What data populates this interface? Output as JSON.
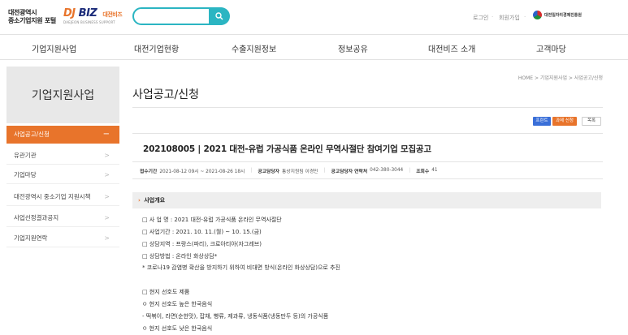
{
  "header": {
    "portal_name_line1": "대전광역시",
    "portal_name_line2": "중소기업지원 포털",
    "brand_dj": "DJ",
    "brand_biz": "BIZ",
    "brand_kr": "대전비즈",
    "brand_sub": "DAEJEON BUSINESS SUPPORT",
    "search_placeholder": "",
    "login_label": "로그인",
    "join_label": "회원가입",
    "util_dot": "·",
    "org_logo_text": "대전일자리경제진흥원",
    "accent_color": "#e8742b",
    "search_color": "#2bb5c2"
  },
  "nav": {
    "items": [
      "기업지원사업",
      "대전기업현황",
      "수출지원정보",
      "정보공유",
      "대전비즈 소개",
      "고객마당"
    ]
  },
  "sidebar": {
    "title": "기업지원사업",
    "items": [
      {
        "label": "사업공고/신청",
        "active": true,
        "icon": "−"
      },
      {
        "label": "유관기관",
        "active": false,
        "icon": ">"
      },
      {
        "label": "기업마당",
        "active": false,
        "icon": ">"
      },
      {
        "label": "대전광역시 중소기업 지원시책",
        "active": false,
        "icon": ">"
      },
      {
        "label": "사업선정결과공지",
        "active": false,
        "icon": ">"
      },
      {
        "label": "기업지원연락",
        "active": false,
        "icon": ">"
      }
    ]
  },
  "content": {
    "breadcrumb": "HOME > 기업지원사업 > 사업공고/신청",
    "page_title": "사업공고/신청",
    "buttons": {
      "print": "프린트",
      "apply": "과제 신청",
      "list": "목록"
    },
    "post_title": "202108005 | 2021 대전-유럽 가공식품 온라인 무역사절단 참여기업 모집공고",
    "meta": {
      "period_label": "접수기간",
      "period_value": "2021-08-12 09시 ~ 2021-08-26 18시",
      "manager_label": "공고담당자",
      "manager_value": "통상지원팀 이경민",
      "phone_label": "공고담당자 연락처",
      "phone_value": "042-380-3044",
      "views_label": "조회수",
      "views_value": "41"
    },
    "section_title": "사업개요",
    "section_mark": "›",
    "body_lines": [
      "□ 사 업 명 : 2021 대전-유럽 가공식품 온라인 무역사절단",
      "□ 사업기간 : 2021. 10. 11.(월) ~ 10. 15.(금)",
      "□ 상담지역 : 프랑스(파리), 크로아티아(자그레브)",
      "□ 상담방법 : 온라인 화상상담*",
      "* 코로나19 감염병 확산을 방지하기 위하여 비대면 방식(온라인 화상상담)으로 추진",
      "□ 현지 선호도 제품",
      "ㅇ 현지 선호도 높은 한국음식",
      "- 떡볶이, 라면(순한맛), 잡채, 빵류, 제과류, 냉동식품(냉동만두 등)의 가공식품",
      "ㅇ 현지 선호도 낮은 한국음식"
    ]
  }
}
